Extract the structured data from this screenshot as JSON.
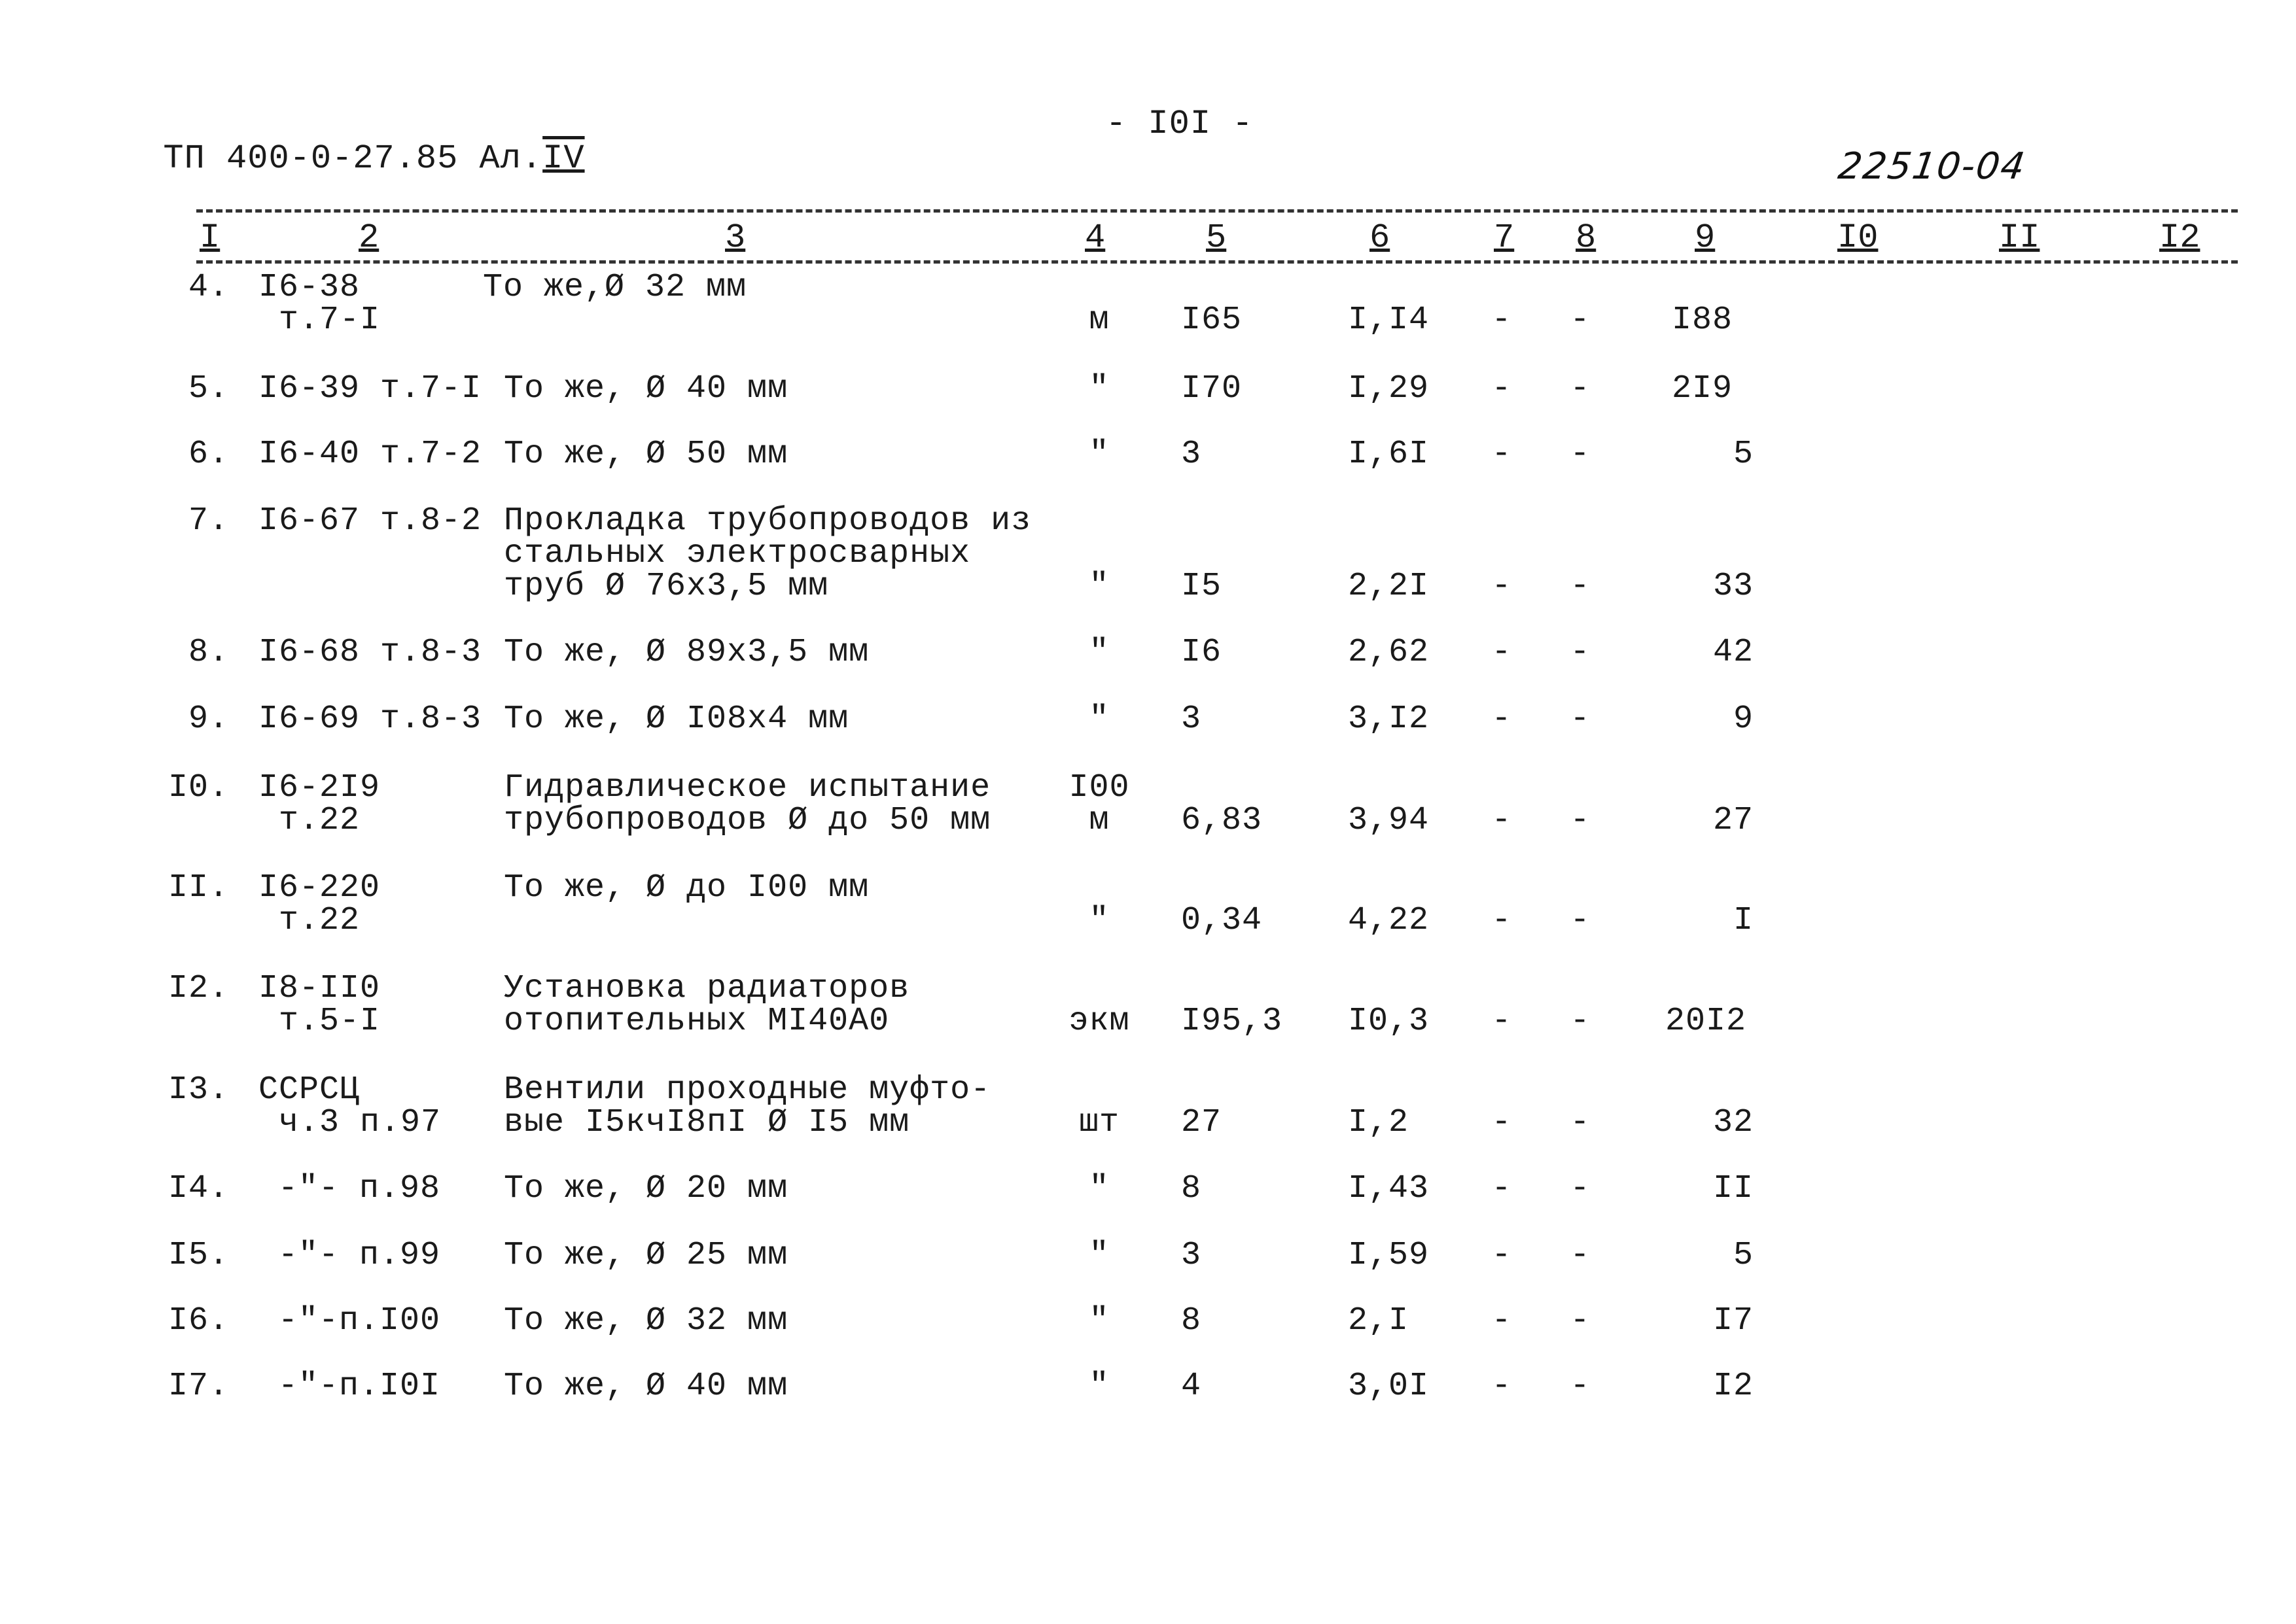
{
  "header": {
    "doc_code": "ТП 400-0-27.85 Ал.",
    "album": "IV",
    "page_number": "- I0I -",
    "handwritten_code": "22510-04"
  },
  "columns": [
    "I",
    "2",
    "3",
    "4",
    "5",
    "6",
    "7",
    "8",
    "9",
    "I0",
    "II",
    "I2"
  ],
  "rows": [
    {
      "num": "4.",
      "code": [
        "I6-38",
        "т.7-I"
      ],
      "desc": [
        "То же,Ø 32 мм"
      ],
      "unit": [
        "м"
      ],
      "qty": "I65",
      "price": "I,I4",
      "c7": "-",
      "c8": "-",
      "total": "I88"
    },
    {
      "num": "5.",
      "code": [
        "I6-39 т.7-I"
      ],
      "desc": [
        "То же, Ø 40 мм"
      ],
      "unit": [
        "\""
      ],
      "qty": "I70",
      "price": "I,29",
      "c7": "-",
      "c8": "-",
      "total": "2I9"
    },
    {
      "num": "6.",
      "code": [
        "I6-40 т.7-2"
      ],
      "desc": [
        "То же, Ø 50 мм"
      ],
      "unit": [
        "\""
      ],
      "qty": "3",
      "price": "I,6I",
      "c7": "-",
      "c8": "-",
      "total": "5"
    },
    {
      "num": "7.",
      "code": [
        "I6-67 т.8-2"
      ],
      "desc": [
        "Прокладка трубопроводов из",
        "стальных электросварных",
        "труб Ø 76х3,5 мм"
      ],
      "unit": [
        "\""
      ],
      "qty": "I5",
      "price": "2,2I",
      "c7": "-",
      "c8": "-",
      "total": "33"
    },
    {
      "num": "8.",
      "code": [
        "I6-68 т.8-3"
      ],
      "desc": [
        "То же, Ø 89х3,5 мм"
      ],
      "unit": [
        "\""
      ],
      "qty": "I6",
      "price": "2,62",
      "c7": "-",
      "c8": "-",
      "total": "42"
    },
    {
      "num": "9.",
      "code": [
        "I6-69 т.8-3"
      ],
      "desc": [
        "То же, Ø I08х4 мм"
      ],
      "unit": [
        "\""
      ],
      "qty": "3",
      "price": "3,I2",
      "c7": "-",
      "c8": "-",
      "total": "9"
    },
    {
      "num": "I0.",
      "code": [
        "I6-2I9",
        "т.22"
      ],
      "desc": [
        "Гидравлическое испытание",
        "трубопроводов Ø до 50 мм"
      ],
      "unit": [
        "I00",
        "м"
      ],
      "qty": "6,83",
      "price": "3,94",
      "c7": "-",
      "c8": "-",
      "total": "27"
    },
    {
      "num": "II.",
      "code": [
        "I6-220",
        "т.22"
      ],
      "desc": [
        "То же, Ø до I00 мм"
      ],
      "unit": [
        "\""
      ],
      "qty": "0,34",
      "price": "4,22",
      "c7": "-",
      "c8": "-",
      "total": "I"
    },
    {
      "num": "I2.",
      "code": [
        "I8-II0",
        "т.5-I"
      ],
      "desc": [
        "Установка радиаторов",
        "отопительных МI40А0"
      ],
      "unit": [
        "экм"
      ],
      "qty": "I95,3",
      "price": "I0,3",
      "c7": "-",
      "c8": "-",
      "total": "20I2"
    },
    {
      "num": "I3.",
      "code": [
        "ССРСЦ",
        "ч.3 п.97"
      ],
      "desc": [
        "Вентили проходные муфто-",
        "вые I5кчI8пI Ø I5 мм"
      ],
      "unit": [
        "шт"
      ],
      "qty": "27",
      "price": "I,2",
      "c7": "-",
      "c8": "-",
      "total": "32"
    },
    {
      "num": "I4.",
      "code": [
        "-\"- п.98"
      ],
      "desc": [
        "То же, Ø 20 мм"
      ],
      "unit": [
        "\""
      ],
      "qty": "8",
      "price": "I,43",
      "c7": "-",
      "c8": "-",
      "total": "II"
    },
    {
      "num": "I5.",
      "code": [
        "-\"- п.99"
      ],
      "desc": [
        "То же, Ø 25 мм"
      ],
      "unit": [
        "\""
      ],
      "qty": "3",
      "price": "I,59",
      "c7": "-",
      "c8": "-",
      "total": "5"
    },
    {
      "num": "I6.",
      "code": [
        "-\"-п.I00"
      ],
      "desc": [
        "То же, Ø 32 мм"
      ],
      "unit": [
        "\""
      ],
      "qty": "8",
      "price": "2,I",
      "c7": "-",
      "c8": "-",
      "total": "I7"
    },
    {
      "num": "I7.",
      "code": [
        "-\"-п.I0I"
      ],
      "desc": [
        "То же, Ø 40 мм"
      ],
      "unit": [
        "\""
      ],
      "qty": "4",
      "price": "3,0I",
      "c7": "-",
      "c8": "-",
      "total": "I2"
    }
  ]
}
